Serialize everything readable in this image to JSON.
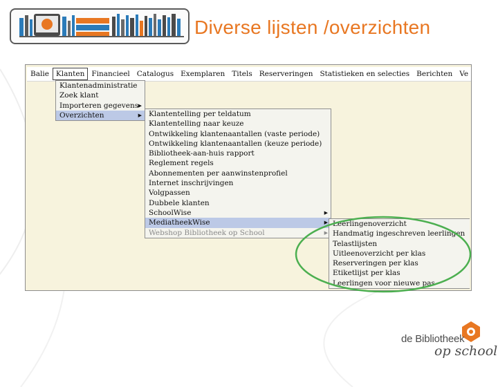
{
  "slide": {
    "title": "Diverse lijsten /overzichten"
  },
  "colors": {
    "title": "#e87722",
    "highlight": "#bcc9e6",
    "app_background": "#f7f3dd",
    "ellipse": "#4caf50",
    "logo_gray": "#4c4c4c",
    "logo_orange": "#e87722"
  },
  "menubar": {
    "items": [
      "Balie",
      "Klanten",
      "Financieel",
      "Catalogus",
      "Exemplaren",
      "Titels",
      "Reserveringen",
      "Statistieken en selecties",
      "Berichten",
      "Ve"
    ],
    "active": "Klanten"
  },
  "klanten_menu": {
    "items": [
      "Klantenadministratie",
      "Zoek klant",
      "Importeren gegevens",
      "Overzichten"
    ],
    "selected": "Overzichten"
  },
  "overzichten_menu": {
    "items": [
      "Klantentelling per teldatum",
      "Klantentelling naar keuze",
      "Ontwikkeling klantenaantallen (vaste periode)",
      "Ontwikkeling klantenaantallen (keuze periode)",
      "Bibliotheek-aan-huis rapport",
      "Reglement regels",
      "Abonnementen per aanwinstenprofiel",
      "Internet inschrijvingen",
      "Volgpassen",
      "Dubbele klanten",
      "SchoolWise",
      "MediatheekWise",
      "Webshop Bibliotheek op School"
    ],
    "selected": "MediatheekWise"
  },
  "mediatheekwise_menu": {
    "items": [
      "Leerlingenoverzicht",
      "Handmatig ingeschreven leerlingen",
      "Telastlijsten",
      "Uitleenoverzicht per klas",
      "Reserveringen per klas",
      "Etiketlijst per klas",
      "Leerlingen voor nieuwe pas"
    ]
  },
  "logo": {
    "line1": "de Bibliotheek",
    "line2": "op school"
  }
}
